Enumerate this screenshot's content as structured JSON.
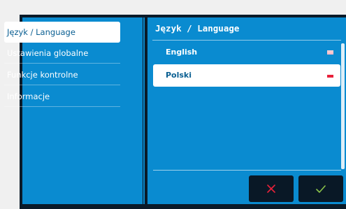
{
  "sidebar": {
    "items": [
      {
        "label": "Język / Language",
        "active": true
      },
      {
        "label": "Ustawienia globalne",
        "active": false
      },
      {
        "label": "Funkcje kontrolne",
        "active": false
      },
      {
        "label": "Informacje",
        "active": false
      }
    ]
  },
  "main": {
    "title": "Język / Language",
    "languages": [
      {
        "label": "English",
        "selected": false,
        "flag_icon": "uk-flag-icon"
      },
      {
        "label": "Polski",
        "selected": true,
        "flag_icon": "poland-flag-icon"
      }
    ]
  },
  "footer": {
    "cancel_icon": "close-icon",
    "confirm_icon": "check-icon"
  },
  "colors": {
    "accent": "#0a8bd0",
    "background": "#0a1a28",
    "cancel": "#e8213a",
    "confirm": "#8bc34a"
  }
}
